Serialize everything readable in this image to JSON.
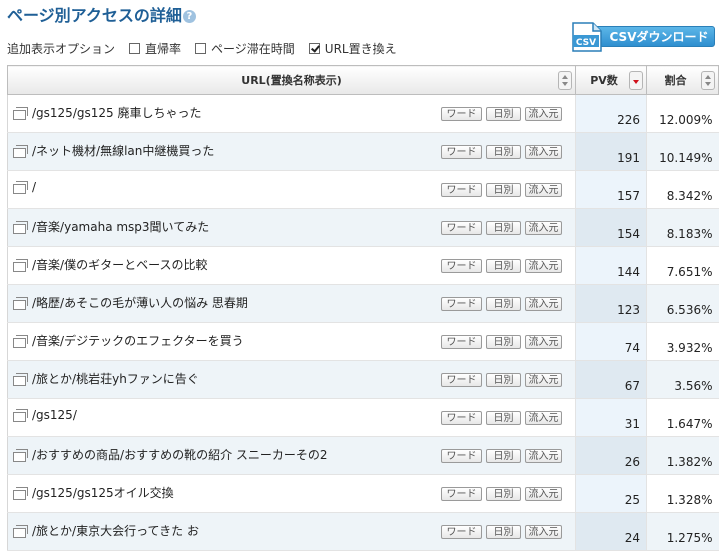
{
  "page": {
    "title": "ページ別アクセスの詳細",
    "help_icon": "help-icon"
  },
  "csv": {
    "label": "CSVダウンロード",
    "icon_text": "CSV"
  },
  "options": {
    "label": "追加表示オプション",
    "items": [
      {
        "label": "直帰率",
        "checked": false
      },
      {
        "label": "ページ滞在時間",
        "checked": false
      },
      {
        "label": "URL置き換え",
        "checked": true
      }
    ]
  },
  "table": {
    "headers": {
      "url": "URL(置換名称表示)",
      "pv": "PV数",
      "pct": "割合"
    },
    "buttons": {
      "word": "ワード",
      "daily": "日別",
      "source": "流入元"
    },
    "rows": [
      {
        "url": "/gs125/gs125  廃車しちゃった",
        "pv": "226",
        "pct": "12.009%"
      },
      {
        "url": "/ネット機材/無線lan中継機買った",
        "pv": "191",
        "pct": "10.149%"
      },
      {
        "url": "/",
        "pv": "157",
        "pct": "8.342%"
      },
      {
        "url": "/音楽/yamaha msp3聞いてみた",
        "pv": "154",
        "pct": "8.183%"
      },
      {
        "url": "/音楽/僕のギターとベースの比較",
        "pv": "144",
        "pct": "7.651%"
      },
      {
        "url": "/略歴/あそこの毛が薄い人の悩み  思春期",
        "pv": "123",
        "pct": "6.536%"
      },
      {
        "url": "/音楽/デジテックのエフェクターを買う",
        "pv": "74",
        "pct": "3.932%"
      },
      {
        "url": "/旅とか/桃岩荘yhファンに告ぐ",
        "pv": "67",
        "pct": "3.56%"
      },
      {
        "url": "/gs125/",
        "pv": "31",
        "pct": "1.647%"
      },
      {
        "url": "/おすすめの商品/おすすめの靴の紹介  スニーカーその2",
        "pv": "26",
        "pct": "1.382%"
      },
      {
        "url": "/gs125/gs125オイル交換",
        "pv": "25",
        "pct": "1.328%"
      },
      {
        "url": "/旅とか/東京大会行ってきた  お",
        "pv": "24",
        "pct": "1.275%"
      }
    ]
  }
}
